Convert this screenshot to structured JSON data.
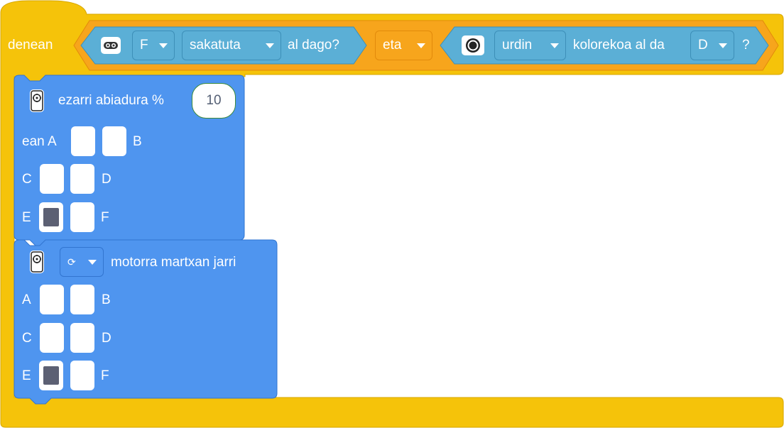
{
  "hat": {
    "label": "denean",
    "sensor1": {
      "icon": "ultrasonic-sensor-icon",
      "port": "F",
      "state": "sakatuta",
      "suffix": "al dago?"
    },
    "operator": "eta",
    "sensor2": {
      "icon": "color-sensor-icon",
      "color": "urdin",
      "text": "kolorekoa al da",
      "port": "D",
      "suffix": "?"
    }
  },
  "block_speed": {
    "icon": "motor-icon",
    "label": "ezarri abiadura %",
    "value": "10",
    "ports_label_prefix": "ean",
    "ports": [
      {
        "name": "A",
        "selected": false
      },
      {
        "name": "B",
        "selected": false
      },
      {
        "name": "C",
        "selected": false
      },
      {
        "name": "D",
        "selected": false
      },
      {
        "name": "E",
        "selected": true
      },
      {
        "name": "F",
        "selected": false
      }
    ]
  },
  "block_run": {
    "icon": "motor-icon",
    "direction_icon": "rotate-clockwise-icon",
    "direction_glyph": "⟳",
    "label": "motorra martxan jarri",
    "ports": [
      {
        "name": "A",
        "selected": false
      },
      {
        "name": "B",
        "selected": false
      },
      {
        "name": "C",
        "selected": false
      },
      {
        "name": "D",
        "selected": false
      },
      {
        "name": "E",
        "selected": true
      },
      {
        "name": "F",
        "selected": false
      }
    ]
  },
  "colors": {
    "hat_yellow": "#f5c30a",
    "hat_border": "#d7a700",
    "operator_orange": "#f7a51c",
    "sensor_blue": "#5bafd6",
    "motor_blue": "#4f95ef",
    "selected_port": "#5c6073"
  }
}
